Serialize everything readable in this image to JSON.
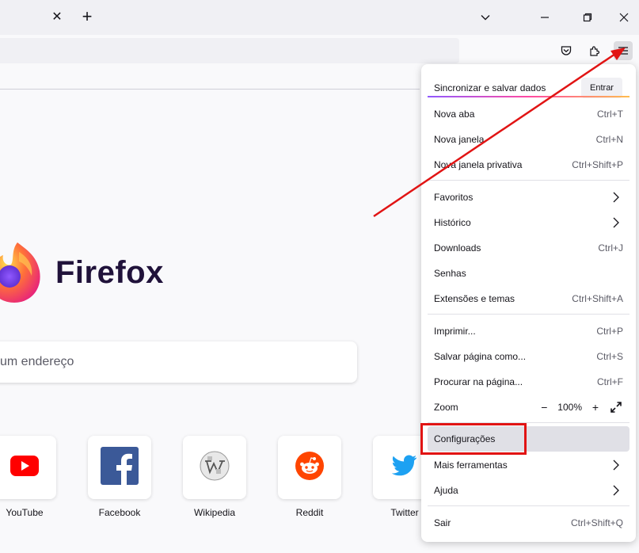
{
  "tabstrip": {
    "close_tab_icon": "close-icon",
    "new_tab_icon": "plus-icon",
    "list_tabs_icon": "chevron-down-icon",
    "minimize_icon": "minimize-icon",
    "restore_icon": "restore-icon",
    "close_window_icon": "close-window-icon"
  },
  "navbar": {
    "pocket_icon": "pocket-icon",
    "extensions_icon": "extensions-icon",
    "menu_icon": "hamburger-menu-icon"
  },
  "content": {
    "brand": "Firefox",
    "search_placeholder": "um endereço",
    "shortcuts": [
      {
        "label": "YouTube",
        "icon": "youtube-icon",
        "color": "#ff0000"
      },
      {
        "label": "Facebook",
        "icon": "facebook-icon",
        "color": "#3b5998"
      },
      {
        "label": "Wikipedia",
        "icon": "wikipedia-icon",
        "color": "#666666"
      },
      {
        "label": "Reddit",
        "icon": "reddit-icon",
        "color": "#ff4500"
      },
      {
        "label": "Twitter",
        "icon": "twitter-icon",
        "color": "#1da1f2"
      }
    ]
  },
  "menu": {
    "sync_label": "Sincronizar e salvar dados",
    "sync_button": "Entrar",
    "items": [
      {
        "label": "Nova aba",
        "shortcut": "Ctrl+T"
      },
      {
        "label": "Nova janela",
        "shortcut": "Ctrl+N"
      },
      {
        "label": "Nova janela privativa",
        "shortcut": "Ctrl+Shift+P"
      },
      {
        "label": "Favoritos",
        "shortcut": ""
      },
      {
        "label": "Histórico",
        "shortcut": ""
      },
      {
        "label": "Downloads",
        "shortcut": "Ctrl+J"
      },
      {
        "label": "Senhas",
        "shortcut": ""
      },
      {
        "label": "Extensões e temas",
        "shortcut": "Ctrl+Shift+A"
      },
      {
        "label": "Imprimir...",
        "shortcut": "Ctrl+P"
      },
      {
        "label": "Salvar página como...",
        "shortcut": "Ctrl+S"
      },
      {
        "label": "Procurar na página...",
        "shortcut": "Ctrl+F"
      },
      {
        "label": "Zoom",
        "shortcut": ""
      },
      {
        "label": "Configurações",
        "shortcut": ""
      },
      {
        "label": "Mais ferramentas",
        "shortcut": ""
      },
      {
        "label": "Ajuda",
        "shortcut": ""
      },
      {
        "label": "Sair",
        "shortcut": "Ctrl+Shift+Q"
      }
    ],
    "zoom": {
      "minus": "−",
      "value": "100%",
      "plus": "+"
    }
  },
  "colors": {
    "annotation_red": "#e11414",
    "accent_purple": "#9059ff"
  }
}
